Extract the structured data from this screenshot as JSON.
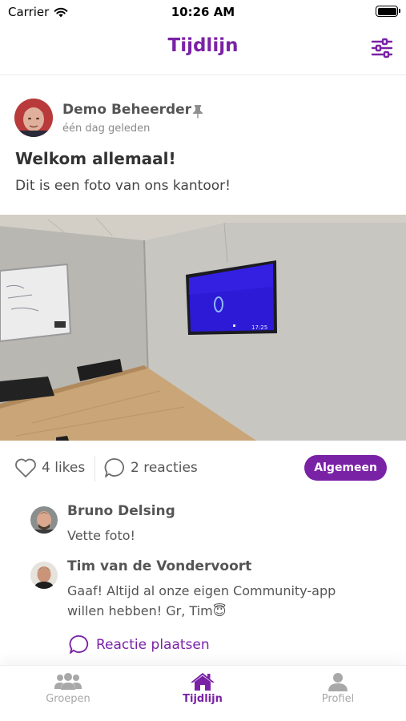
{
  "status_bar": {
    "carrier": "Carrier",
    "time": "10:26 AM"
  },
  "header": {
    "title": "Tijdlijn",
    "filter_icon": "sliders-icon"
  },
  "post": {
    "author": "Demo Beheerder",
    "time_ago": "één dag geleden",
    "pinned_icon": "pin-icon",
    "title": "Welkom allemaal!",
    "body": "Dit is een foto van ons kantoor!",
    "likes": "4 likes",
    "comments_count": "2 reacties",
    "category": "Algemeen",
    "tv_clock": "17:25"
  },
  "comments": [
    {
      "author": "Bruno Delsing",
      "text": "Vette foto!"
    },
    {
      "author": "Tim van de Vondervoort",
      "text": "Gaaf! Altijd al onze eigen Community-app willen hebben! Gr, Tim😇"
    }
  ],
  "reply_label": "Reactie plaatsen",
  "tabs": [
    {
      "label": "Groepen",
      "icon": "users-icon",
      "active": false
    },
    {
      "label": "Tijdlijn",
      "icon": "home-icon",
      "active": true
    },
    {
      "label": "Profiel",
      "icon": "user-icon",
      "active": false
    }
  ],
  "colors": {
    "accent": "#7a22a6",
    "inactive": "#a8a8a8"
  }
}
